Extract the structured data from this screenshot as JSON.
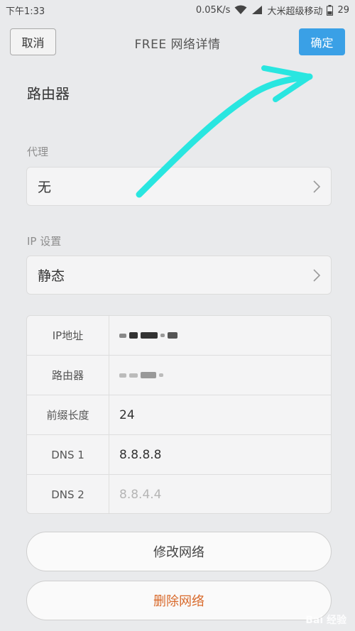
{
  "status": {
    "time": "下午1:33",
    "speed": "0.05K/s",
    "carrier": "大米超级移动",
    "battery": "29"
  },
  "header": {
    "cancel_label": "取消",
    "title": "FREE 网络详情",
    "confirm_label": "确定"
  },
  "router_heading": "路由器",
  "proxy": {
    "label": "代理",
    "value": "无"
  },
  "ip_settings": {
    "label": "IP 设置",
    "value": "静态"
  },
  "ip_table": {
    "rows": [
      {
        "label": "IP地址",
        "value": ""
      },
      {
        "label": "路由器",
        "value": ""
      },
      {
        "label": "前缀长度",
        "value": "24"
      },
      {
        "label": "DNS 1",
        "value": "8.8.8.8"
      },
      {
        "label": "DNS 2",
        "value": "8.8.4.4"
      }
    ]
  },
  "buttons": {
    "modify_label": "修改网络",
    "delete_label": "删除网络"
  },
  "watermark": "Bai 经验",
  "colors": {
    "accent": "#3aa0e6",
    "danger": "#d8692a",
    "annotation": "#29e6e0"
  }
}
